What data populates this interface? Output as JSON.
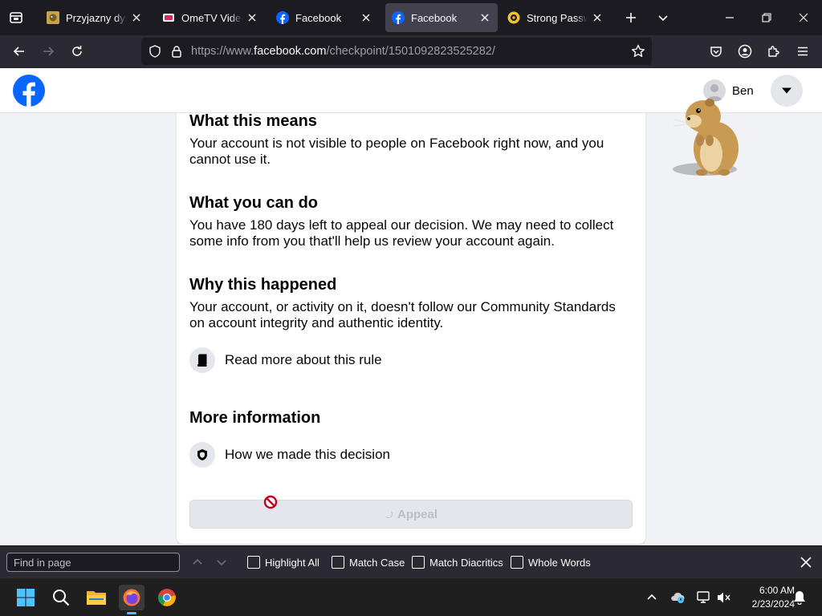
{
  "browser": {
    "tabs": [
      {
        "title": "Przyjazny dysk i",
        "favicon": "hamster-site-icon",
        "active": false
      },
      {
        "title": "OmeTV Video C",
        "favicon": "ometv-icon",
        "active": false
      },
      {
        "title": "Facebook",
        "favicon": "facebook-icon",
        "active": false
      },
      {
        "title": "Facebook",
        "favicon": "facebook-icon",
        "active": true
      },
      {
        "title": "Strong Passwor",
        "favicon": "password-site-icon",
        "active": false
      }
    ],
    "url_prefix": "https://www.",
    "url_host": "facebook.com",
    "url_path": "/checkpoint/1501092823525282/"
  },
  "header": {
    "profile_name": "Ben"
  },
  "sections": {
    "means_heading": "What this means",
    "means_text": "Your account is not visible to people on Facebook right now, and you cannot use it.",
    "cando_heading": "What you can do",
    "cando_text": "You have 180 days left to appeal our decision. We may need to collect some info from you that'll help us review your account again.",
    "why_heading": "Why this happened",
    "why_text": "Your account, or activity on it, doesn't follow our Community Standards on account integrity and authentic identity.",
    "rule_link": "Read more about this rule",
    "more_heading": "More information",
    "decision_link": "How we made this decision",
    "appeal_label": "Appeal"
  },
  "findbar": {
    "placeholder": "Find in page",
    "options": [
      "Highlight All",
      "Match Case",
      "Match Diacritics",
      "Whole Words"
    ]
  },
  "taskbar": {
    "time": "6:00 AM",
    "date": "2/23/2024"
  },
  "colors": {
    "facebook_blue": "#0866ff",
    "browser_frame": "#1c1b22",
    "toolbar": "#2b2a33",
    "page_bg": "#f0f2f5"
  }
}
